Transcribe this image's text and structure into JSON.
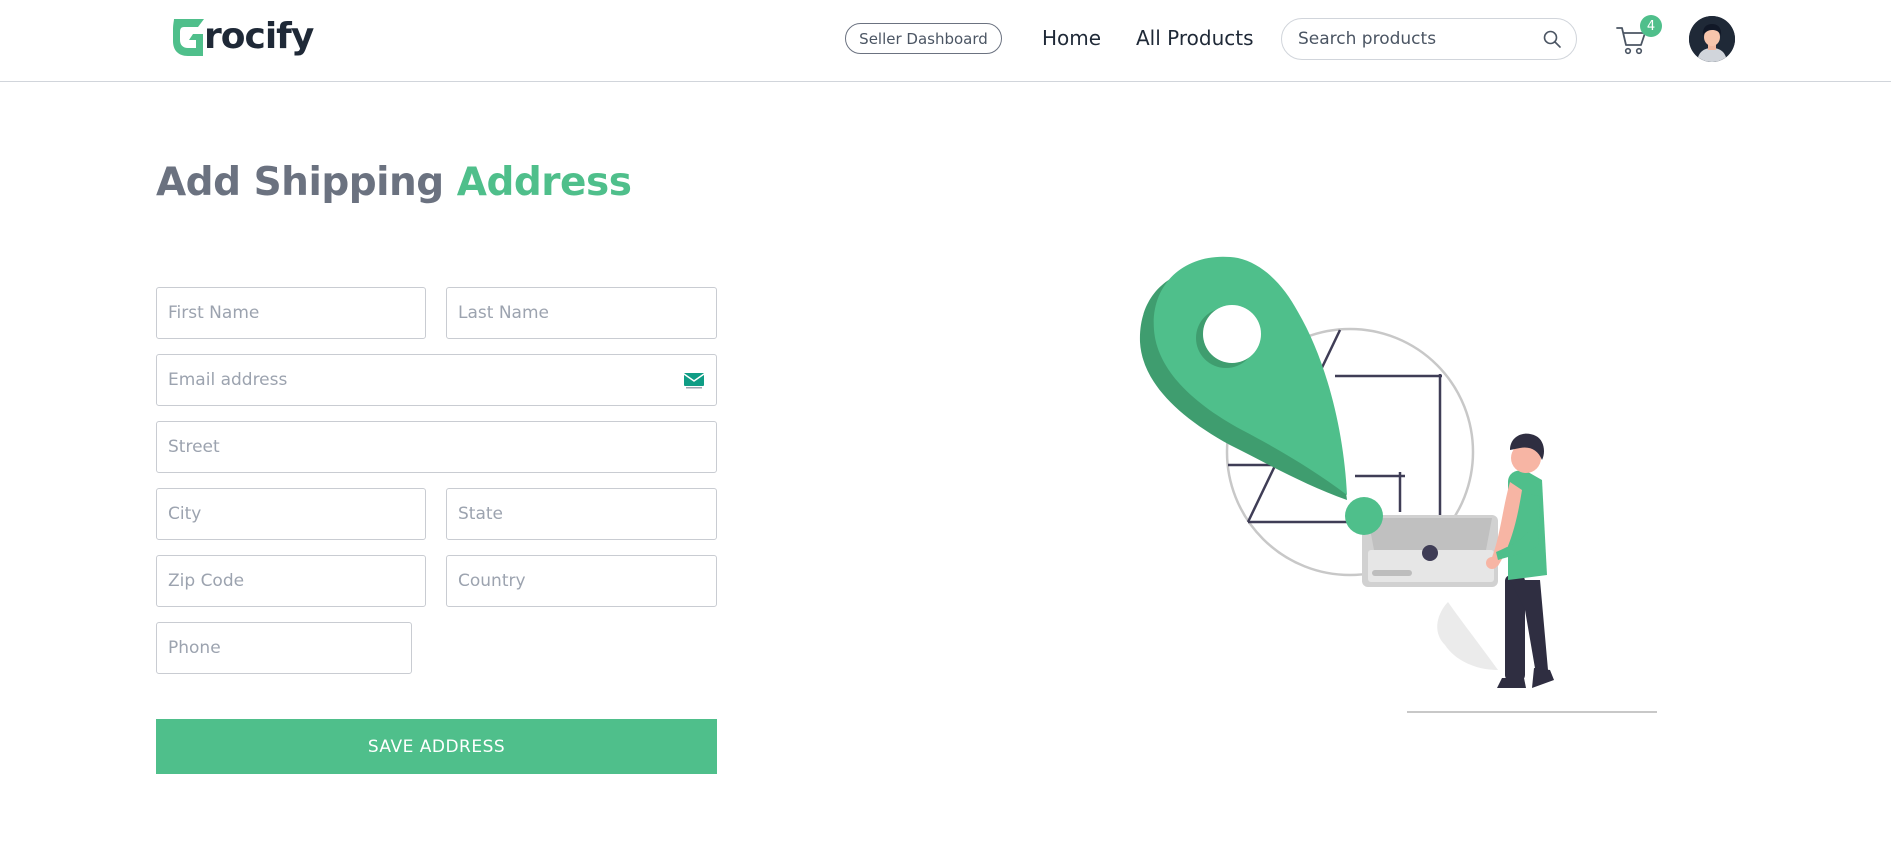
{
  "brand": {
    "name": "rocify",
    "logo_initial": "G",
    "primary_color": "#4fbf8b",
    "text_color": "#1f2937"
  },
  "navbar": {
    "seller_dashboard_label": "Seller Dashboard",
    "links": [
      {
        "label": "Home"
      },
      {
        "label": "All Products"
      }
    ],
    "search": {
      "placeholder": "Search products",
      "value": "",
      "icon": "search-icon"
    },
    "cart": {
      "icon": "cart-icon",
      "count": "4"
    },
    "avatar": {
      "icon": "user-avatar"
    }
  },
  "page": {
    "title_main": "Add Shipping ",
    "title_accent": "Address"
  },
  "form": {
    "first_name": {
      "placeholder": "First Name",
      "value": ""
    },
    "last_name": {
      "placeholder": "Last Name",
      "value": ""
    },
    "email": {
      "placeholder": "Email address",
      "value": "",
      "icon": "mail-icon"
    },
    "street": {
      "placeholder": "Street",
      "value": ""
    },
    "city": {
      "placeholder": "City",
      "value": ""
    },
    "state": {
      "placeholder": "State",
      "value": ""
    },
    "zip": {
      "placeholder": "Zip Code",
      "value": ""
    },
    "country": {
      "placeholder": "Country",
      "value": ""
    },
    "phone": {
      "placeholder": "Phone",
      "value": ""
    },
    "submit_label": "SAVE ADDRESS"
  },
  "illustration": {
    "name": "delivery-location-illustration"
  }
}
